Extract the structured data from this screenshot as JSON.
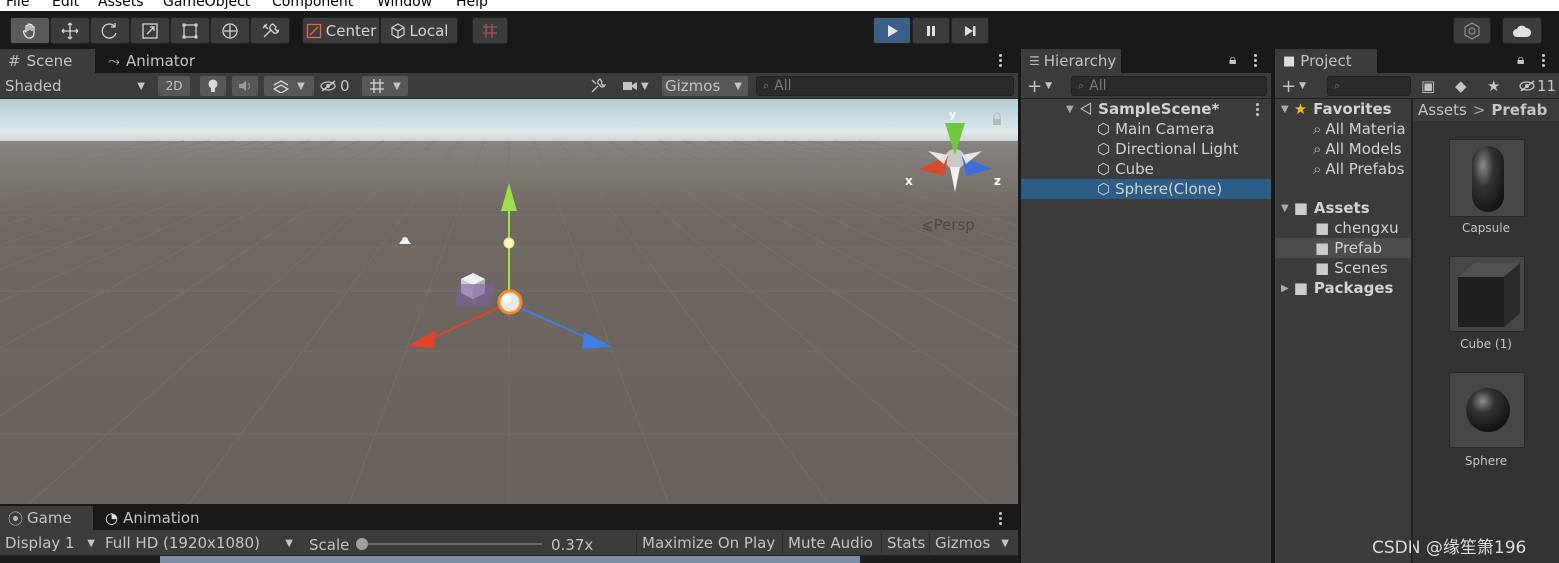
{
  "menu": [
    "File",
    "Edit",
    "Assets",
    "GameObject",
    "Component",
    "Window",
    "Help"
  ],
  "toolbar": {
    "tools": [
      "hand-icon",
      "move-icon",
      "rotate-icon",
      "scale-icon",
      "rect-icon",
      "transform-icon",
      "custom-tool-icon"
    ],
    "center_label": "Center",
    "local_label": "Local",
    "snap_icon": "grid-snap-icon",
    "play_icon": "play-icon",
    "pause_icon": "pause-icon",
    "step_icon": "step-icon",
    "collab_icon": "collab-icon",
    "cloud_icon": "cloud-icon"
  },
  "scene": {
    "tabs": [
      {
        "label": "Scene"
      },
      {
        "label": "Animator"
      }
    ],
    "shading_mode": "Shaded",
    "mode_2d": "2D",
    "hidden_count": "0",
    "gizmos_label": "Gizmos",
    "search_placeholder": "All",
    "persp_label": "⩽Persp",
    "gizmo_axes": {
      "x": "x",
      "y": "y",
      "z": "z"
    },
    "colors": {
      "sky": "#c9dbe3",
      "ground": "#6e6762",
      "x_axis": "#e0452a",
      "y_axis": "#9be04a",
      "z_axis": "#3f7fe6"
    }
  },
  "game": {
    "tabs": [
      {
        "label": "Game"
      },
      {
        "label": "Animation"
      }
    ],
    "display": "Display 1",
    "resolution": "Full HD (1920x1080)",
    "scale_label": "Scale",
    "scale_value": "0.37x",
    "scale_fraction": 0.0,
    "buttons": [
      "Maximize On Play",
      "Mute Audio",
      "Stats",
      "Gizmos"
    ]
  },
  "hierarchy": {
    "tab_label": "Hierarchy",
    "search_placeholder": "All",
    "scene_name": "SampleScene*",
    "items": [
      {
        "label": "Main Camera"
      },
      {
        "label": "Directional Light"
      },
      {
        "label": "Cube"
      },
      {
        "label": "Sphere(Clone)",
        "selected": true
      }
    ]
  },
  "project": {
    "tab_label": "Project",
    "hidden_count": "11",
    "favorites_label": "Favorites",
    "favorites": [
      "All Materia",
      "All Models",
      "All Prefabs"
    ],
    "assets_label": "Assets",
    "folders": [
      "chengxu",
      "Prefab",
      "Scenes"
    ],
    "packages_label": "Packages",
    "breadcrumb": {
      "root": "Assets",
      "sep": ">",
      "current": "Prefab"
    },
    "prefabs": [
      {
        "name": "Capsule",
        "icon": "capsule-icon"
      },
      {
        "name": "Cube (1)",
        "icon": "cube-icon"
      },
      {
        "name": "Sphere",
        "icon": "sphere-icon"
      }
    ]
  },
  "watermark": "CSDN @缘笙箫196"
}
